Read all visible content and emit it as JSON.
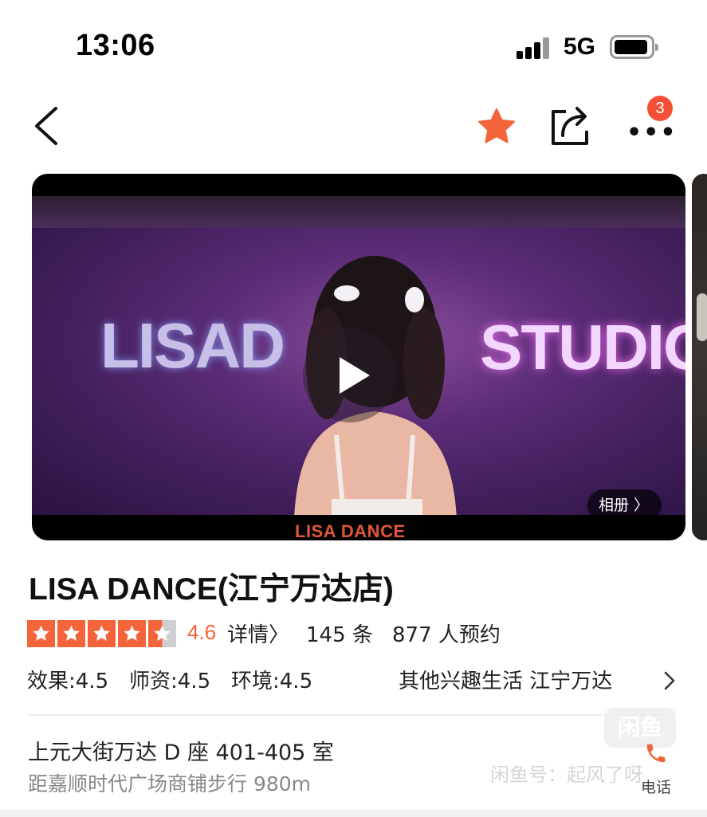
{
  "status_bar": {
    "time": "13:06",
    "network": "5G",
    "signal_icon": "cellular-signal-icon",
    "battery_icon": "battery-icon"
  },
  "nav": {
    "back_icon": "chevron-left-icon",
    "favorite_icon": "star-icon",
    "share_icon": "share-icon",
    "more_icon": "more-dots-icon",
    "more_dots": "•••",
    "more_badge": "3",
    "accent_color": "#f3643b"
  },
  "hero": {
    "wall_text_left": "LISAD",
    "wall_text_right": "STUDIO",
    "logo_text": "LISA DANCE",
    "album_label": "相册 〉",
    "play_icon": "play-icon"
  },
  "shop": {
    "title": "LISA DANCE(江宁万达店)",
    "rating": {
      "stars": 4.5,
      "score": "4.6",
      "detail_label": "详情〉",
      "review_count": "145 条",
      "booking_count": "877 人预约"
    },
    "scores": [
      "效果:4.5",
      "师资:4.5",
      "环境:4.5"
    ],
    "category": "其他兴趣生活  江宁万达",
    "address": "上元大街万达 D 座 401-405 室",
    "distance": "距嘉顺时代广场商铺步行 980m",
    "phone_label": "电话",
    "phone_icon": "phone-icon"
  },
  "watermark": {
    "logo": "闲鱼",
    "text": "闲鱼号：起风了呀"
  }
}
